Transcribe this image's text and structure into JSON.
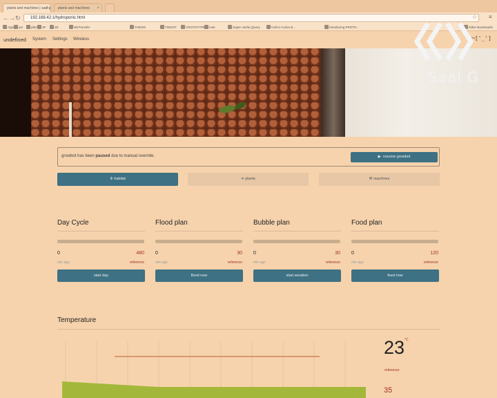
{
  "browser": {
    "tabs": [
      {
        "label": "plants and machines | saal g"
      },
      {
        "label": "plants and machines"
      }
    ],
    "url": "192.168.42.1/hydroponic.html",
    "bookmarks": [
      "Apps",
      "pm",
      "pibm",
      "SF",
      "ZE",
      "WeTransfer",
      "THESIS",
      "TWOOT",
      "CROTOTYPE",
      "note",
      "Super useful jQuery",
      "Call-to-Action B...",
      "Introducing PROTO...",
      "Other Bookmarks"
    ]
  },
  "nav": {
    "brand": "undefined",
    "links": [
      "System",
      "Settings",
      "Wireless"
    ],
    "emoticon": "¬['_']"
  },
  "hero": {
    "logo_text": "Saal G"
  },
  "alert": {
    "prefix": "growbot has been",
    "status": "paused",
    "suffix": "due to manual override.",
    "button": "resume growbot"
  },
  "sections": [
    {
      "label": "habitat",
      "icon": "sun-icon",
      "active": true
    },
    {
      "label": "plants",
      "icon": "leaf-icon",
      "active": false
    },
    {
      "label": "machines",
      "icon": "wrench-icon",
      "active": false
    }
  ],
  "cards": [
    {
      "title": "Day Cycle",
      "value": "0",
      "reference": "480",
      "min_label": "min ago",
      "ref_label": "reference",
      "progress": 0,
      "button": "start day"
    },
    {
      "title": "Flood plan",
      "value": "0",
      "reference": "30",
      "min_label": "min ago",
      "ref_label": "reference",
      "progress": 0,
      "button": "flood now"
    },
    {
      "title": "Bubble plan",
      "value": "0",
      "reference": "30",
      "min_label": "min ago",
      "ref_label": "reference",
      "progress": 0,
      "button": "start aeration"
    },
    {
      "title": "Food plan",
      "value": "0",
      "reference": "120",
      "min_label": "min ago",
      "ref_label": "reference",
      "progress": 0,
      "button": "feed now"
    }
  ],
  "temperature": {
    "title": "Temperature",
    "value": "23",
    "unit": "°C",
    "reference_label": "reference:",
    "reference_value": "35",
    "colors": {
      "area": "#a3b83a",
      "reference_line": "#b85c33"
    }
  }
}
